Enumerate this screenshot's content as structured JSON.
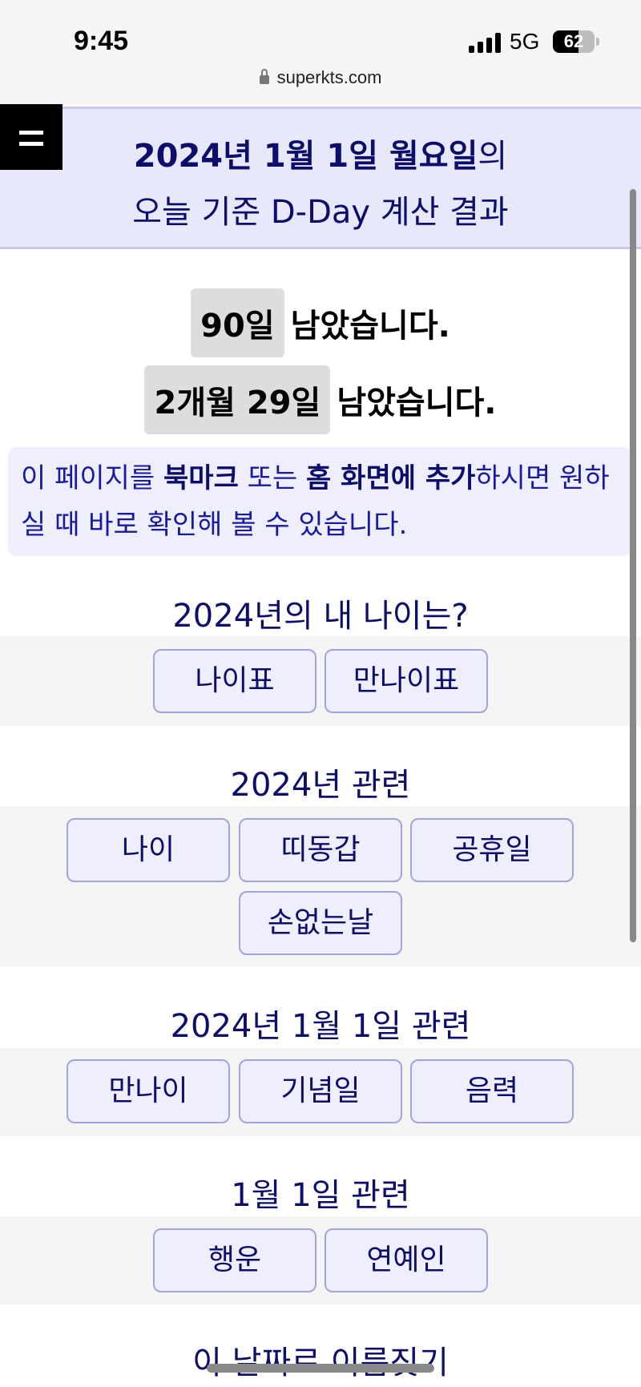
{
  "status": {
    "time": "9:45",
    "network": "5G",
    "battery": "62",
    "battery_level": 0.62,
    "url": "superkts.com"
  },
  "header": {
    "date_bold": "2024년 1월 1일 월요일",
    "date_suffix": "의",
    "subtitle": "오늘 기준 D-Day 계산 결과"
  },
  "results": [
    {
      "value": "90일",
      "suffix": "남았습니다."
    },
    {
      "value": "2개월 29일",
      "suffix": "남았습니다."
    }
  ],
  "notice": {
    "part1": "이 페이지를 ",
    "bookmark": "북마크",
    "part2": " 또는 ",
    "home_screen": "홈 화면에 추가",
    "part3": "하시면 원하실 때 바로 확인해 볼 수 있습니다."
  },
  "sections": [
    {
      "title": "2024년의 내 나이는?",
      "buttons": [
        "나이표",
        "만나이표"
      ]
    },
    {
      "title": "2024년 관련",
      "buttons": [
        "나이",
        "띠동갑",
        "공휴일",
        "손없는날"
      ]
    },
    {
      "title": "2024년 1월 1일 관련",
      "buttons": [
        "만나이",
        "기념일",
        "음력"
      ]
    },
    {
      "title": "1월 1일 관련",
      "buttons": [
        "행운",
        "연예인"
      ]
    },
    {
      "title": "이 날짜로 이름짓기",
      "buttons": []
    }
  ],
  "icons": {
    "menu": "hamburger-menu-icon",
    "lock": "lock-icon",
    "signal": "signal-bars-icon",
    "battery": "battery-icon"
  },
  "colors": {
    "primary_text": "#0d0d6b",
    "header_bg": "#e8e8fb",
    "button_bg": "#eeeefc",
    "button_border": "#a3a3de",
    "result_highlight": "#dddddd"
  }
}
